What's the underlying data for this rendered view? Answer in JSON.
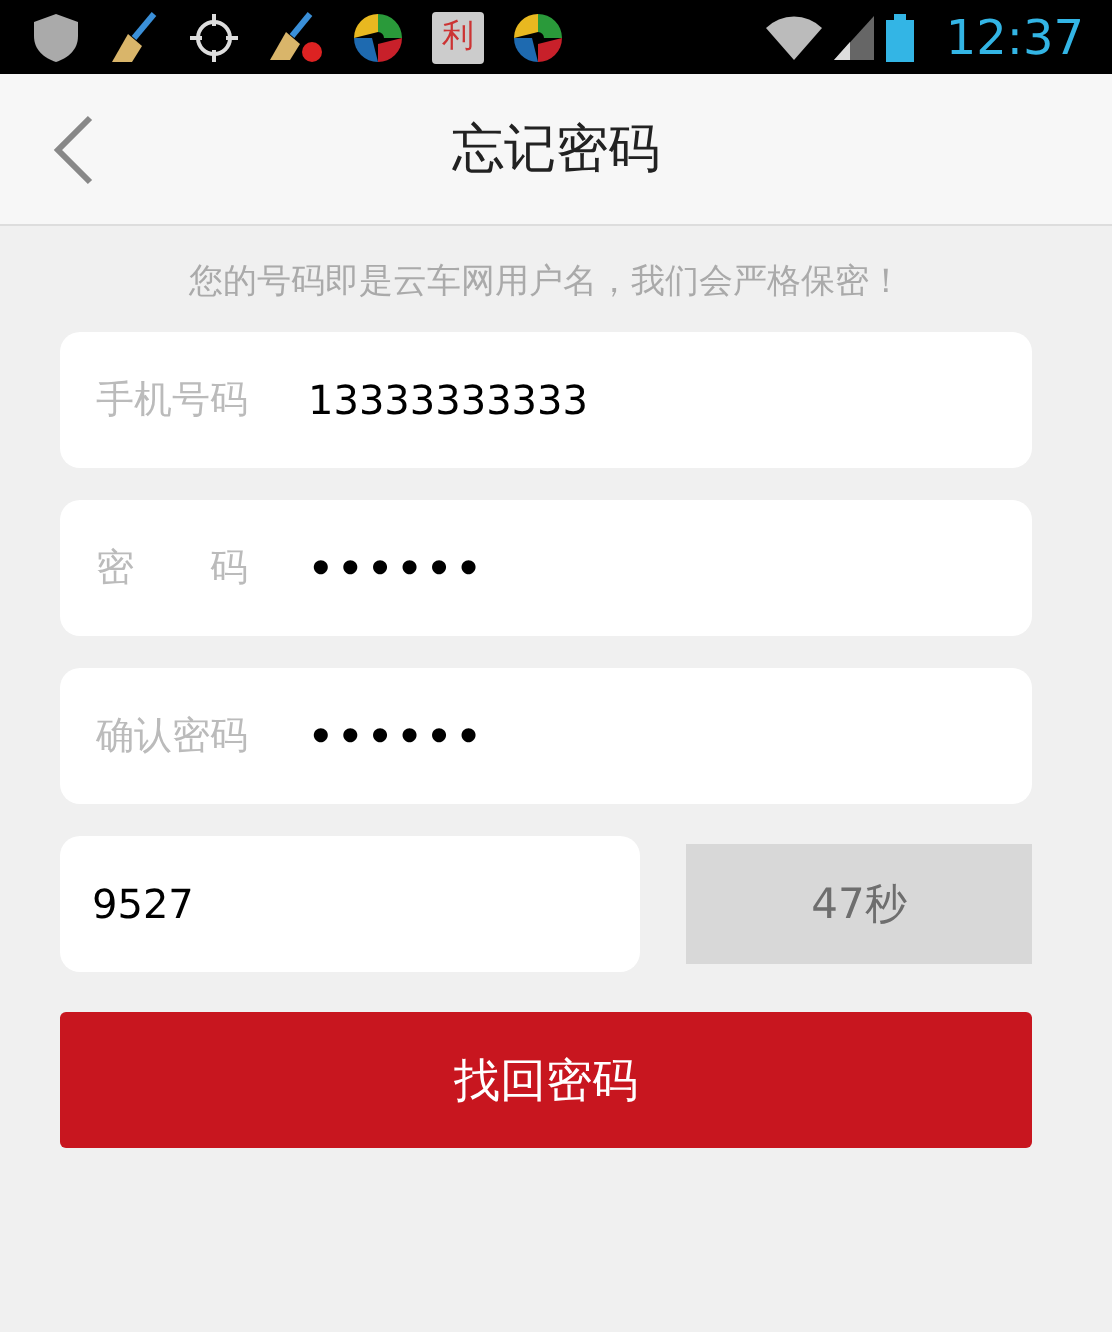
{
  "status_bar": {
    "icons": [
      {
        "kind": "shield"
      },
      {
        "kind": "broom"
      },
      {
        "kind": "crosshair"
      },
      {
        "kind": "broom-alert"
      },
      {
        "kind": "swirl"
      },
      {
        "kind": "app",
        "glyph": "利"
      },
      {
        "kind": "swirl"
      }
    ],
    "time": "12:37"
  },
  "header": {
    "title": "忘记密码"
  },
  "hint": "您的号码即是云车网用户名，我们会严格保密！",
  "fields": [
    {
      "label": "手机号码",
      "value": "13333333333",
      "kind": "text"
    },
    {
      "label": "密　　码",
      "value": "••••••",
      "kind": "password"
    },
    {
      "label": "确认密码",
      "value": "••••••",
      "kind": "password"
    }
  ],
  "code": {
    "value": "9527",
    "button": "47秒",
    "disabled": true
  },
  "submit": "找回密码"
}
